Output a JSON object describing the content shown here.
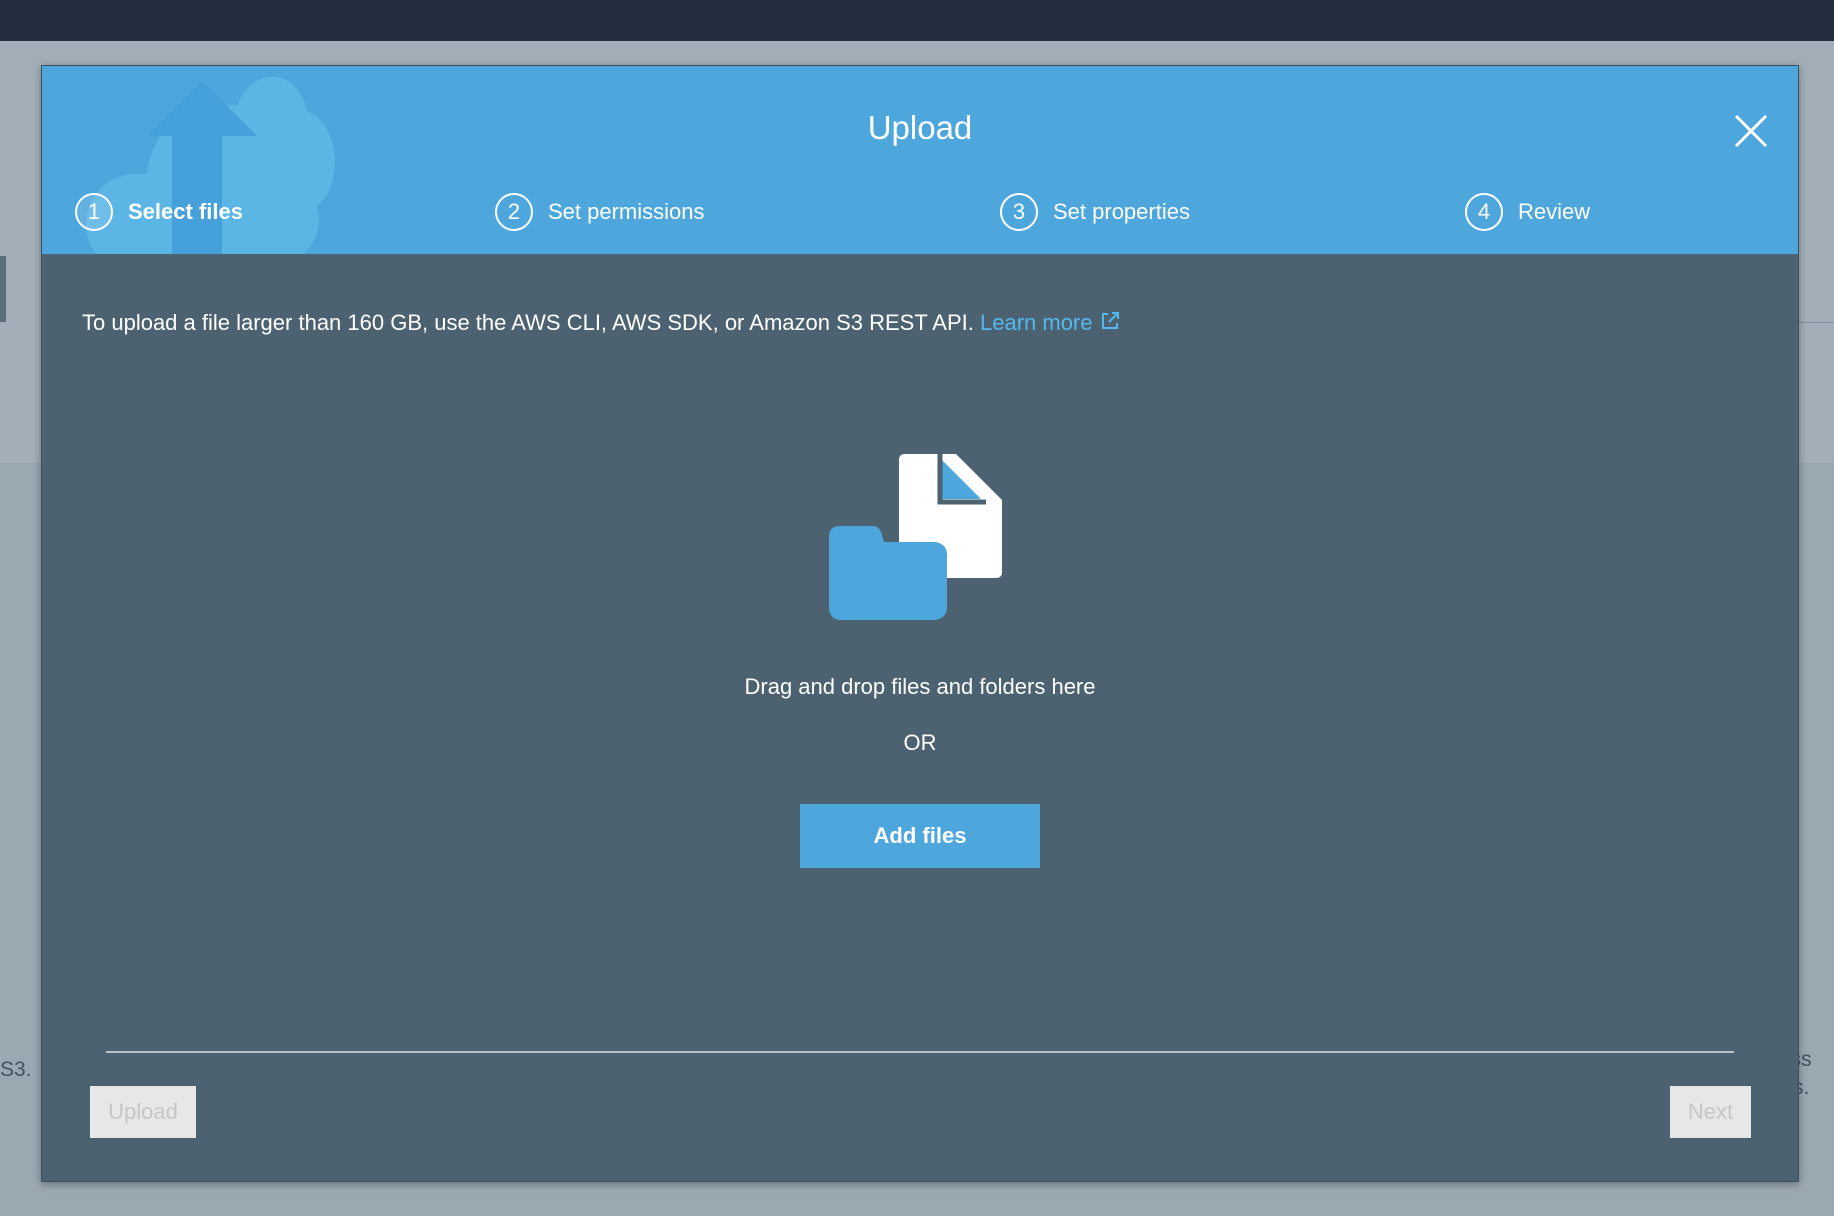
{
  "background": {
    "left_text": "S3.",
    "right_text_lines": [
      "iss",
      "rs."
    ]
  },
  "modal": {
    "title": "Upload",
    "steps": [
      {
        "number": "1",
        "label": "Select files",
        "active": true
      },
      {
        "number": "2",
        "label": "Set permissions",
        "active": false
      },
      {
        "number": "3",
        "label": "Set properties",
        "active": false
      },
      {
        "number": "4",
        "label": "Review",
        "active": false
      }
    ],
    "notice": {
      "text": "To upload a file larger than 160 GB, use the AWS CLI, AWS SDK, or Amazon S3 REST API.",
      "link_label": "Learn more",
      "link_icon": "external-link-icon"
    },
    "dropzone": {
      "icon": "folder-and-file-icon",
      "text": "Drag and drop files and folders here",
      "or_label": "OR",
      "add_files_label": "Add files"
    },
    "footer": {
      "upload_label": "Upload",
      "next_label": "Next"
    }
  },
  "colors": {
    "header_blue": "#4ea7dc",
    "modal_body": "#4c6271",
    "link": "#52b8f0",
    "top_bar": "#232f3e"
  }
}
